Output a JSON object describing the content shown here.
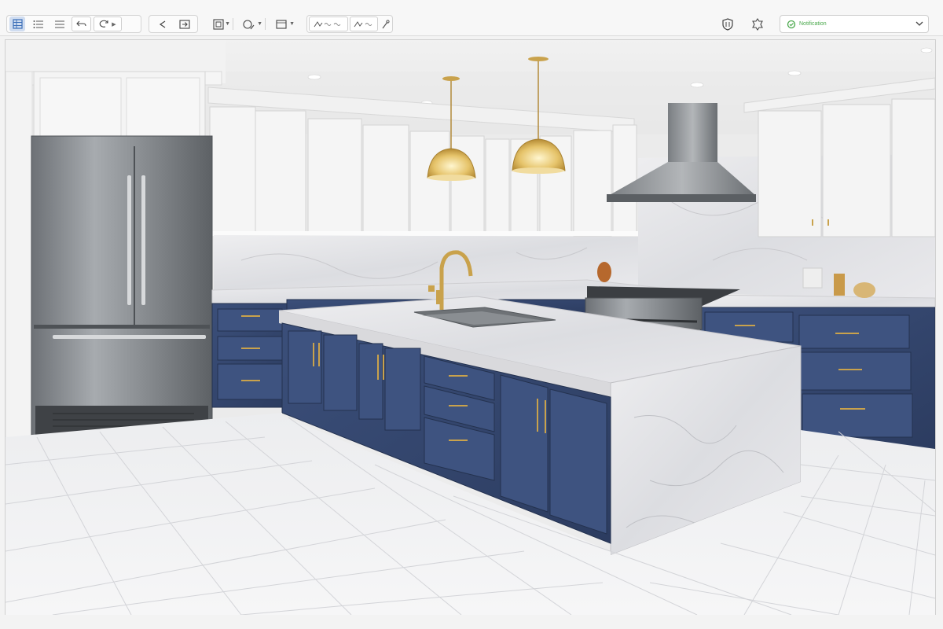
{
  "toolbar": {
    "tools": [
      {
        "name": "grid-view-icon",
        "active": true
      },
      {
        "name": "list-view-icon"
      },
      {
        "name": "menu-lines-icon"
      },
      {
        "name": "undo-icon"
      },
      {
        "name": "redo-icon"
      },
      {
        "name": "back-icon"
      },
      {
        "name": "export-icon"
      },
      {
        "name": "frame-icon"
      },
      {
        "name": "shapes-icon"
      },
      {
        "name": "crop-icon"
      },
      {
        "name": "trim-icon"
      },
      {
        "name": "edit-link-icon"
      },
      {
        "name": "settings-icon"
      }
    ],
    "right_icons": [
      "shield-icon",
      "badge-icon"
    ]
  },
  "workspace": {
    "value": "Notification",
    "accent": "#49a84b"
  },
  "canvas": {
    "image": "kitchen-render",
    "colors": {
      "cabinet_navy": "#34466e",
      "cabinet_white": "#f4f4f4",
      "marble": "#e7e7ea",
      "brass": "#c9a24c",
      "steel": "#8e9296",
      "floor_tile": "#f1f1f3"
    }
  }
}
